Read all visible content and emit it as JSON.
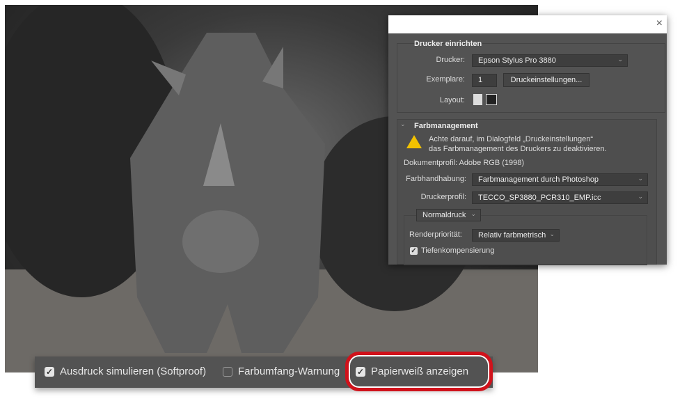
{
  "dialog": {
    "close_icon": "×",
    "printer_setup": {
      "title": "Drucker einrichten",
      "printer_label": "Drucker:",
      "printer_value": "Epson Stylus Pro 3880",
      "copies_label": "Exemplare:",
      "copies_value": "1",
      "print_settings_button": "Druckeinstellungen...",
      "layout_label": "Layout:"
    },
    "color_management": {
      "title": "Farbmanagement",
      "warning_line1": "Achte darauf, im Dialogfeld „Druckeinstellungen“",
      "warning_line2": "das Farbmanagement des Druckers zu deaktivieren.",
      "document_profile": "Dokumentprofil: Adobe RGB (1998)",
      "color_handling_label": "Farbhandhabung:",
      "color_handling_value": "Farbmanagement durch Photoshop",
      "printer_profile_label": "Druckerprofil:",
      "printer_profile_value": "TECCO_SP3880_PCR310_EMP.icc",
      "mode_value": "Normaldruck",
      "rendering_intent_label": "Renderpriorität:",
      "rendering_intent_value": "Relativ farbmetrisch",
      "black_point_label": "Tiefenkompensierung",
      "black_point_checked": true
    }
  },
  "proof_bar": {
    "items": [
      {
        "label": "Ausdruck simulieren (Softproof)",
        "checked": true
      },
      {
        "label": "Farbumfang-Warnung",
        "checked": false
      },
      {
        "label": "Papierweiß anzeigen",
        "checked": true
      }
    ],
    "highlight_color": "#d0121b"
  }
}
